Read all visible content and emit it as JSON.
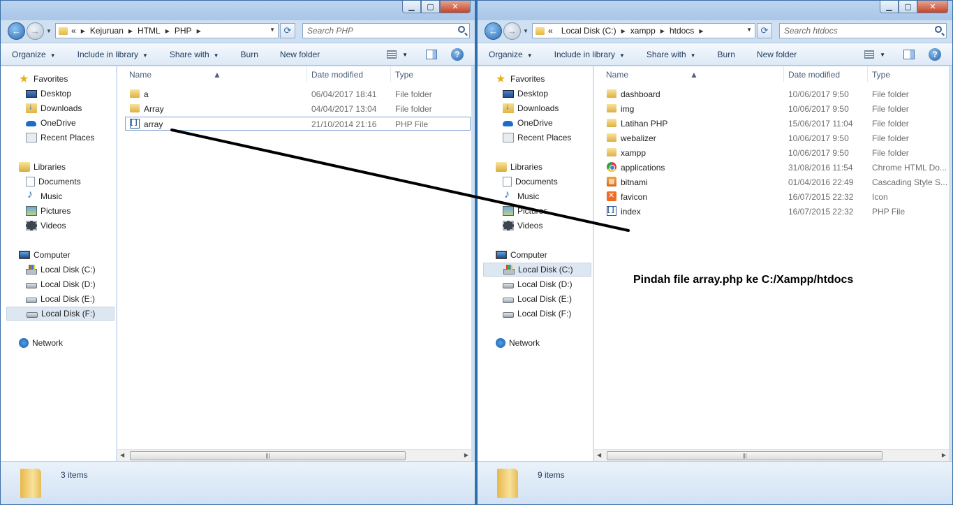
{
  "toolbar_labels": {
    "organize": "Organize",
    "include": "Include in library",
    "share": "Share with",
    "burn": "Burn",
    "new_folder": "New folder"
  },
  "columns": {
    "name": "Name",
    "date": "Date modified",
    "type": "Type"
  },
  "nav": {
    "favorites": "Favorites",
    "desktop": "Desktop",
    "downloads": "Downloads",
    "onedrive": "OneDrive",
    "recent": "Recent Places",
    "libraries": "Libraries",
    "documents": "Documents",
    "music": "Music",
    "pictures": "Pictures",
    "videos": "Videos",
    "computer": "Computer",
    "disk_c": "Local Disk (C:)",
    "disk_d": "Local Disk (D:)",
    "disk_e": "Local Disk (E:)",
    "disk_f": "Local Disk (F:)",
    "network": "Network"
  },
  "left": {
    "breadcrumb": [
      "«",
      "Kejuruan",
      "HTML",
      "PHP"
    ],
    "search_placeholder": "Search PHP",
    "selected_nav": "disk_f",
    "files": [
      {
        "name": "a",
        "date": "06/04/2017 18:41",
        "type": "File folder",
        "icon": "folder-icon"
      },
      {
        "name": "Array",
        "date": "04/04/2017 13:04",
        "type": "File folder",
        "icon": "folder-icon"
      },
      {
        "name": "array",
        "date": "21/10/2014 21:16",
        "type": "PHP File",
        "icon": "php-icon",
        "selected": true
      }
    ],
    "status": "3 items"
  },
  "right": {
    "breadcrumb": [
      "«",
      "Local Disk (C:)",
      "xampp",
      "htdocs"
    ],
    "search_placeholder": "Search htdocs",
    "selected_nav": "disk_c",
    "files": [
      {
        "name": "dashboard",
        "date": "10/06/2017 9:50",
        "type": "File folder",
        "icon": "folder-icon"
      },
      {
        "name": "img",
        "date": "10/06/2017 9:50",
        "type": "File folder",
        "icon": "folder-icon"
      },
      {
        "name": "Latihan PHP",
        "date": "15/06/2017 11:04",
        "type": "File folder",
        "icon": "folder-icon"
      },
      {
        "name": "webalizer",
        "date": "10/06/2017 9:50",
        "type": "File folder",
        "icon": "folder-icon"
      },
      {
        "name": "xampp",
        "date": "10/06/2017 9:50",
        "type": "File folder",
        "icon": "folder-icon"
      },
      {
        "name": "applications",
        "date": "31/08/2016 11:54",
        "type": "Chrome HTML Do...",
        "icon": "chrome-icon"
      },
      {
        "name": "bitnami",
        "date": "01/04/2016 22:49",
        "type": "Cascading Style S...",
        "icon": "css-icon"
      },
      {
        "name": "favicon",
        "date": "16/07/2015 22:32",
        "type": "Icon",
        "icon": "xampp-icon"
      },
      {
        "name": "index",
        "date": "16/07/2015 22:32",
        "type": "PHP File",
        "icon": "php-icon"
      }
    ],
    "status": "9 items"
  },
  "annotation": "Pindah file array.php ke C:/Xampp/htdocs"
}
